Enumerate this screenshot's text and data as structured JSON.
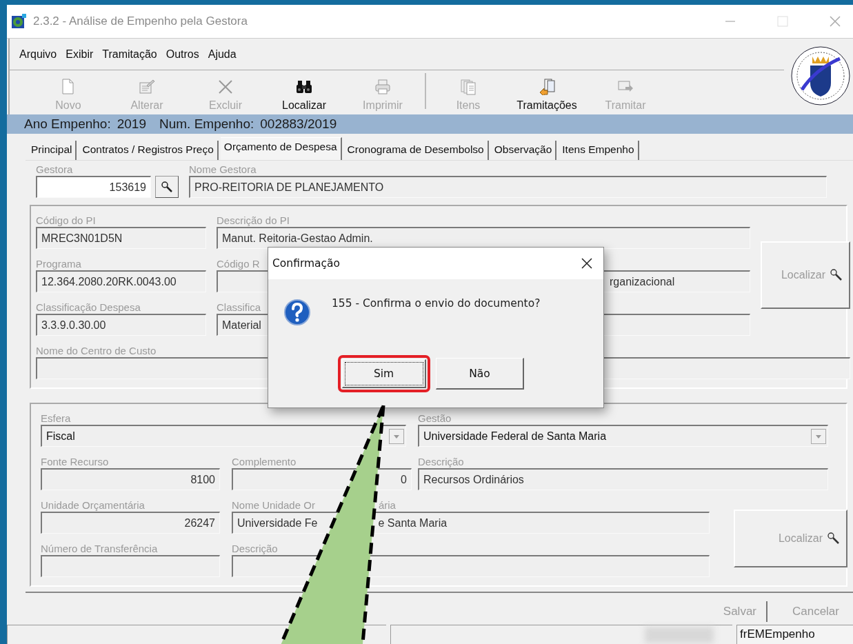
{
  "window": {
    "title": "2.3.2 - Análise de Empenho pela Gestora"
  },
  "menu": [
    {
      "label": "Arquivo"
    },
    {
      "label": "Exibir"
    },
    {
      "label": "Tramitação"
    },
    {
      "label": "Outros"
    },
    {
      "label": "Ajuda"
    }
  ],
  "toolbar": [
    {
      "buttons": [
        {
          "label": "Novo",
          "kind": "new",
          "disabled": true
        },
        {
          "label": "Alterar",
          "kind": "edit",
          "disabled": true
        },
        {
          "label": "Excluir",
          "kind": "delete",
          "disabled": true
        },
        {
          "label": "Localizar",
          "kind": "find",
          "disabled": false
        },
        {
          "label": "Imprimir",
          "kind": "print",
          "disabled": true
        }
      ]
    },
    {
      "buttons": [
        {
          "label": "Itens",
          "kind": "items",
          "disabled": true
        },
        {
          "label": "Tramitações",
          "kind": "routes",
          "disabled": false
        },
        {
          "label": "Tramitar",
          "kind": "send",
          "disabled": true
        }
      ]
    }
  ],
  "record_bar": {
    "items": [
      "Ano Empenho:",
      "2019",
      "Num. Empenho:",
      "002883/2019"
    ]
  },
  "tabs": [
    {
      "label": "Principal",
      "selected": false
    },
    {
      "label": "Contratos / Registros Preço",
      "selected": false
    },
    {
      "label": "Orçamento de Despesa",
      "selected": true
    },
    {
      "label": "Cronograma de Desembolso",
      "selected": false
    },
    {
      "label": "Observação",
      "selected": false
    },
    {
      "label": "Itens Empenho",
      "selected": false
    }
  ],
  "header_fields": [
    {
      "label": "Gestora",
      "value": "153619",
      "editable": true,
      "lookup": true
    },
    {
      "label": "Nome Gestora",
      "value": "PRO-REITORIA DE PLANEJAMENTO",
      "editable": false
    }
  ],
  "groups": [
    {
      "fields": [
        {
          "label": "Código do PI",
          "value": "MREC3N01D5N",
          "kind": "text"
        },
        {
          "label": "Descrição do PI",
          "value": "Manut. Reitoria-Gestao Admin.",
          "kind": "text"
        },
        {
          "label": "Programa",
          "value": "12.364.2080.20RK.0043.00",
          "kind": "text"
        },
        {
          "label": "Código R",
          "value": "rganizacional",
          "kind": "text"
        },
        {
          "label": "Classificação Despesa",
          "value": "3.3.9.0.30.00",
          "kind": "text"
        },
        {
          "label": "Classifica",
          "value": "Material",
          "kind": "text"
        },
        {
          "label": "Nome do Centro de Custo",
          "kind": "text"
        }
      ],
      "button": {
        "label": "Localizar",
        "disabled": true
      }
    },
    {
      "fields": [
        {
          "label": "Esfera",
          "value": "Fiscal",
          "kind": "combo"
        },
        {
          "label": "Gestão",
          "value": "Universidade Federal de Santa Maria",
          "kind": "combo"
        },
        {
          "label": "Fonte Recurso",
          "value": "8100",
          "kind": "text"
        },
        {
          "label": "Complemento",
          "value": "0",
          "kind": "text"
        },
        {
          "label": "Descrição",
          "value": "Recursos Ordinários",
          "kind": "text"
        },
        {
          "label": "Unidade Orçamentária",
          "value": "26247",
          "kind": "text"
        },
        {
          "label": [
            "Nome Unidade Or",
            "ária"
          ],
          "value": [
            "Universidade Fe",
            "e Santa Maria"
          ],
          "kind": "text"
        },
        {
          "label": "Número de Transferência",
          "kind": "text"
        },
        {
          "label": "Descrição",
          "kind": "text"
        }
      ],
      "button": {
        "label": "Localizar",
        "disabled": true
      }
    }
  ],
  "actions": [
    {
      "label": "Salvar",
      "disabled": true
    },
    {
      "label": "Cancelar",
      "disabled": true
    }
  ],
  "status_bar": {
    "form_name": "frEMEmpenho"
  },
  "dialog": {
    "title": "Confirmação",
    "message": "155 - Confirma o envio do documento?",
    "buttons": [
      {
        "label": "Sim",
        "focused": true,
        "highlighted": true
      },
      {
        "label": "Não",
        "focused": false,
        "highlighted": false
      }
    ]
  }
}
